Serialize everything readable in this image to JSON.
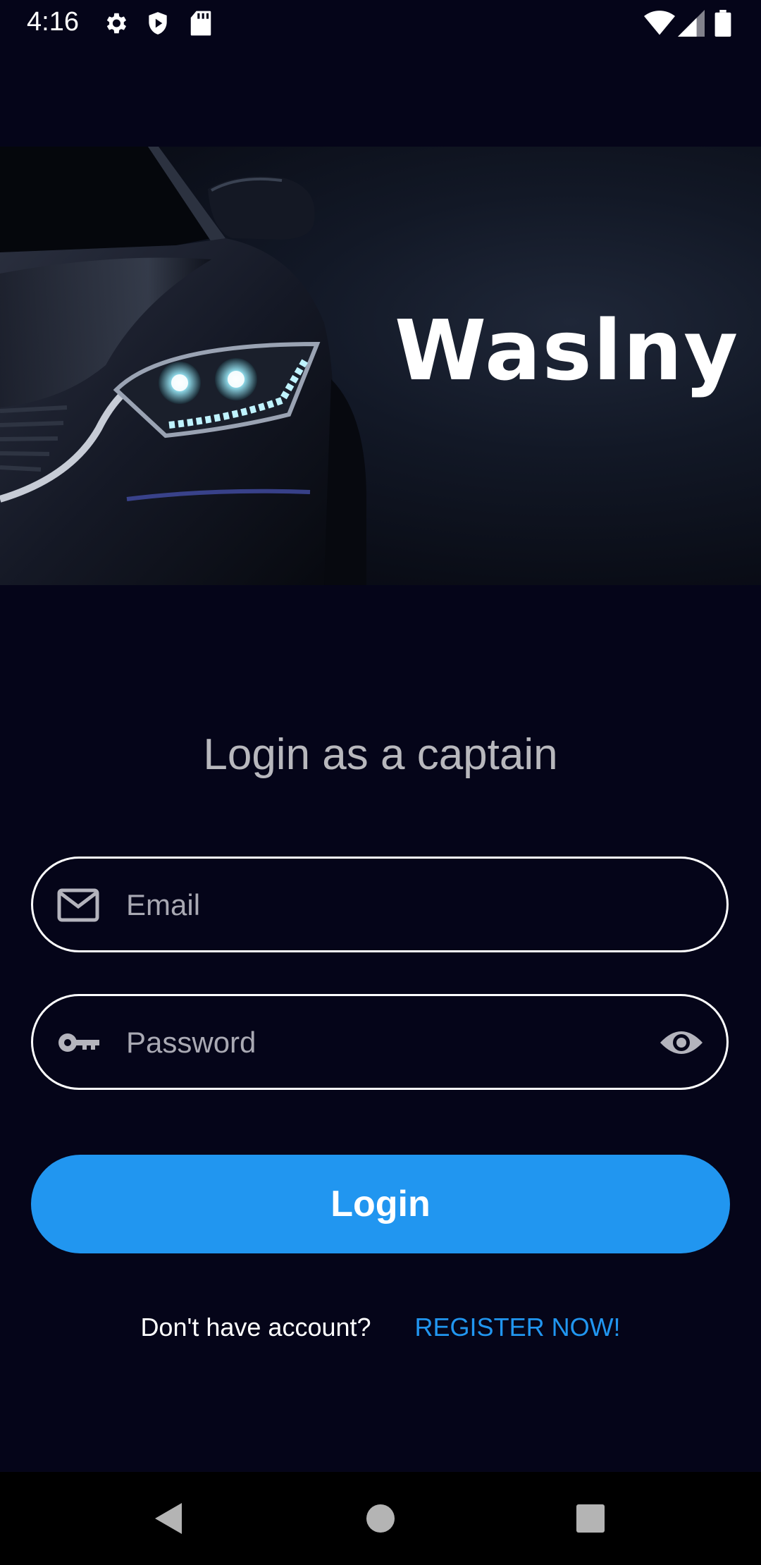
{
  "status_bar": {
    "time": "4:16",
    "icons": [
      "gear-icon",
      "shield-play-icon",
      "sd-card-icon",
      "wifi-icon",
      "cell-signal-icon",
      "battery-icon"
    ]
  },
  "hero": {
    "brand": "Waslny"
  },
  "login": {
    "title": "Login as a captain",
    "email_placeholder": "Email",
    "email_value": "",
    "password_placeholder": "Password",
    "password_value": "",
    "button_label": "Login"
  },
  "register": {
    "prompt": "Don't have account?",
    "link_label": "REGISTER NOW!"
  },
  "colors": {
    "background": "#050519",
    "accent": "#2196f0",
    "field_border": "#ffffff",
    "title_text": "#b8b8bd"
  },
  "nav_bar": {
    "buttons": [
      "back-icon",
      "home-icon",
      "recents-icon"
    ]
  }
}
